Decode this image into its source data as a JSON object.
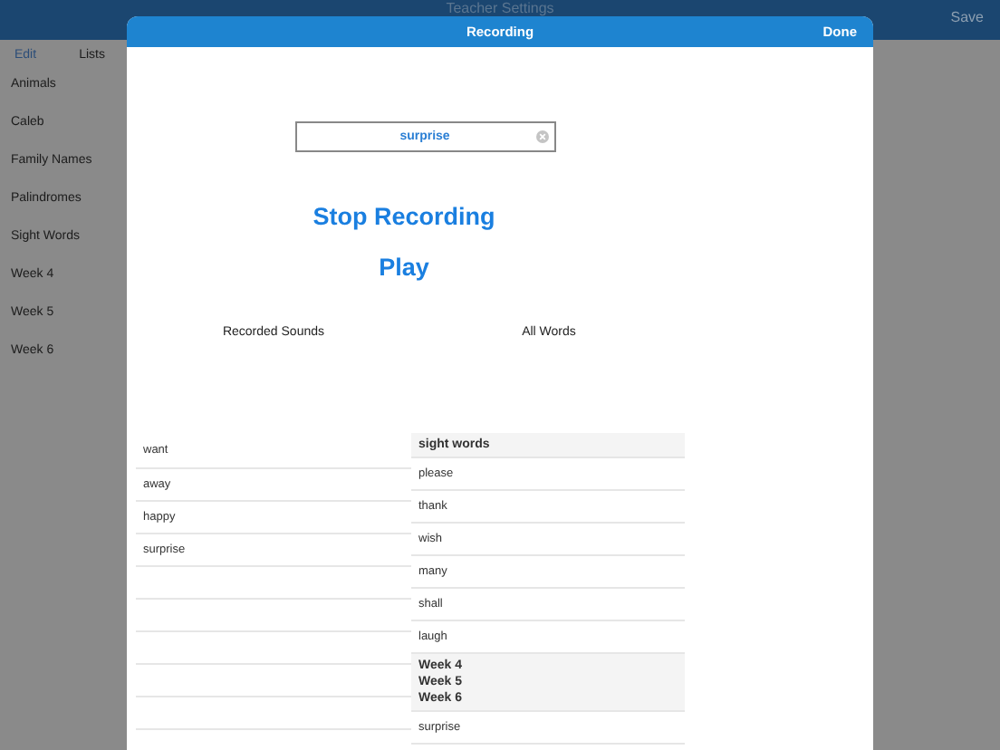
{
  "nav_bar": {
    "title": "Teacher Settings",
    "save": "Save"
  },
  "sidebar": {
    "edit": "Edit",
    "title": "Lists",
    "items": [
      "Animals",
      "Caleb",
      "Family Names",
      "Palindromes",
      "Sight Words",
      "Week 4",
      "Week 5",
      "Week 6"
    ]
  },
  "modal": {
    "title": "Recording",
    "done": "Done",
    "search": {
      "value": "surprise"
    },
    "stop_recording": "Stop Recording",
    "play": "Play",
    "recorded_sounds": {
      "heading": "Recorded Sounds",
      "items": [
        "want",
        "away",
        "happy",
        "surprise"
      ]
    },
    "all_words": {
      "heading": "All Words",
      "items": [
        {
          "kind": "section",
          "lines": [
            "sight words"
          ]
        },
        {
          "kind": "word",
          "text": "please"
        },
        {
          "kind": "word",
          "text": "thank"
        },
        {
          "kind": "word",
          "text": "wish"
        },
        {
          "kind": "word",
          "text": "many"
        },
        {
          "kind": "word",
          "text": "shall"
        },
        {
          "kind": "word",
          "text": "laugh"
        },
        {
          "kind": "section",
          "lines": [
            "Week 4",
            "Week 5",
            "Week 6"
          ]
        },
        {
          "kind": "word",
          "text": "surprise"
        }
      ]
    }
  }
}
